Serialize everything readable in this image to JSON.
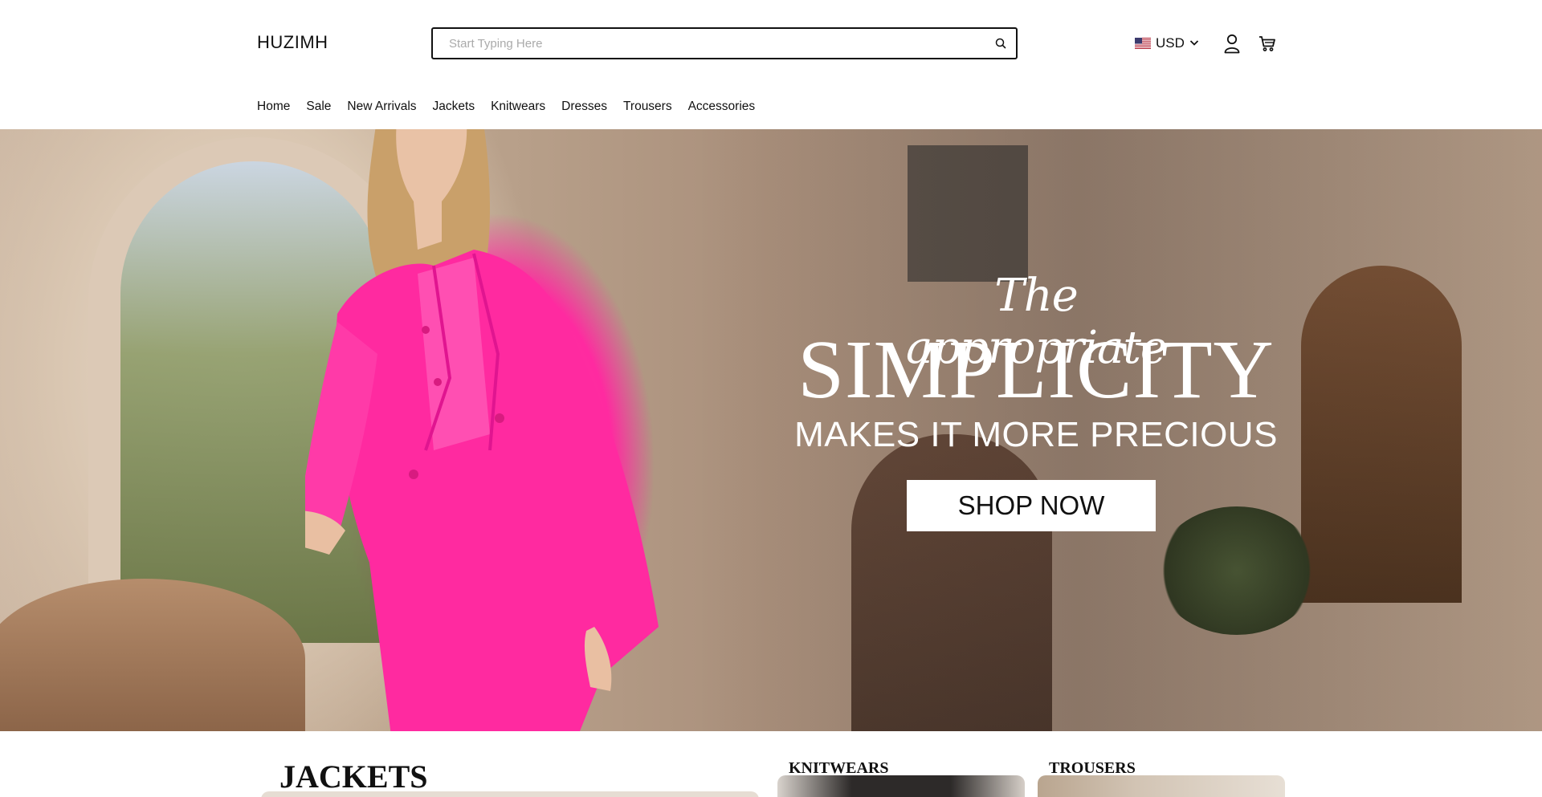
{
  "brand": {
    "logo": "HUZIMH"
  },
  "search": {
    "placeholder": "Start Typing Here",
    "value": ""
  },
  "currency": {
    "label": "USD",
    "flag": "us-flag-icon"
  },
  "icons": {
    "account": "user-icon",
    "cart": "cart-icon",
    "search": "search-icon",
    "chevron": "chevron-down-icon"
  },
  "nav": {
    "items": [
      {
        "label": "Home"
      },
      {
        "label": "Sale"
      },
      {
        "label": "New Arrivals"
      },
      {
        "label": "Jackets"
      },
      {
        "label": "Knitwears"
      },
      {
        "label": "Dresses"
      },
      {
        "label": "Trousers"
      },
      {
        "label": "Accessories"
      }
    ]
  },
  "hero": {
    "script": "The appropriate",
    "title": "SIMPLICITY",
    "subtitle": "MAKES IT MORE PRECIOUS",
    "cta": "SHOP NOW"
  },
  "categories": {
    "jackets": "JACKETS",
    "knitwears": "KNITWEARS",
    "trousers": "TROUSERS"
  },
  "colors": {
    "accent": "#ff2aa0",
    "text": "#111111",
    "background": "#ffffff"
  }
}
